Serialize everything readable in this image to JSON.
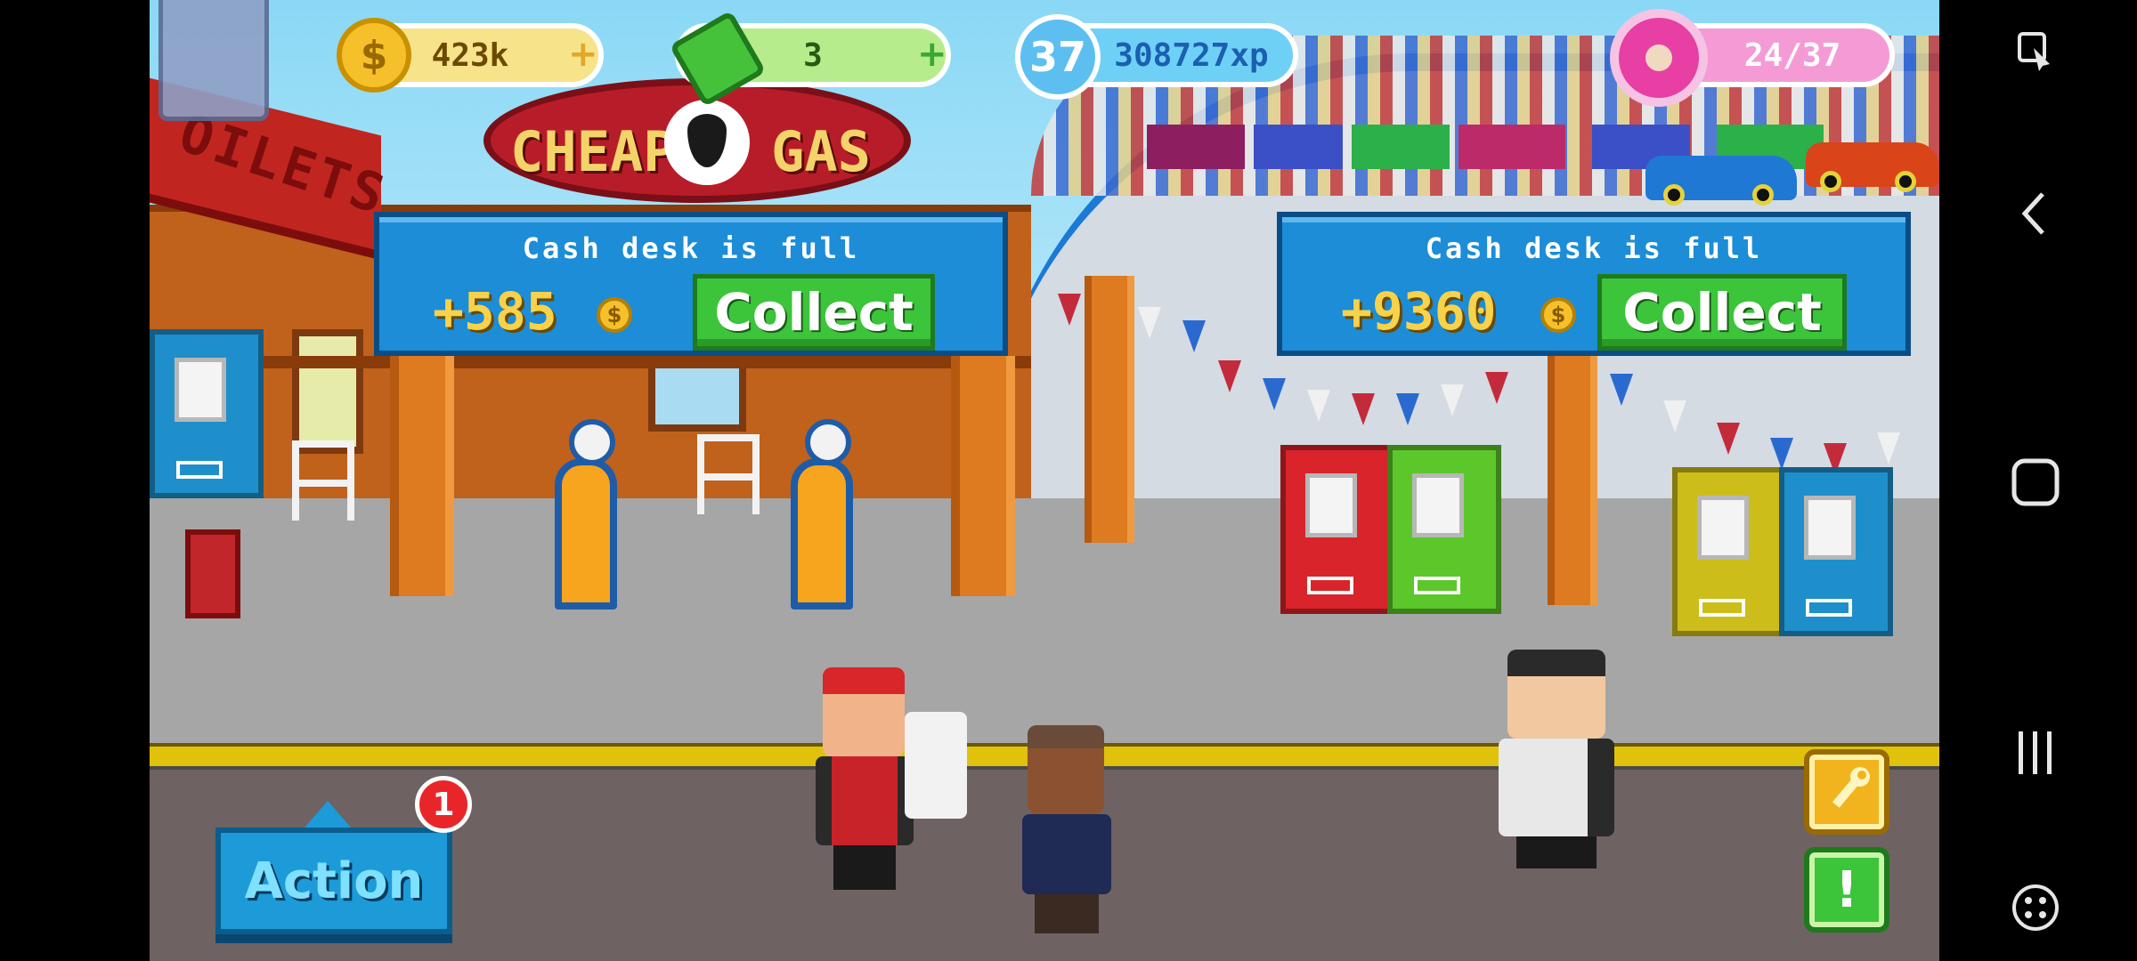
{
  "hud": {
    "coins": "423k",
    "cash": "3",
    "level": "37",
    "xp": "308727xp",
    "donuts": "24/37",
    "coin_symbol": "$",
    "plus": "+"
  },
  "sign": {
    "left": "CHEAP",
    "right": "GAS"
  },
  "building_sign": "OILETS",
  "desk_left": {
    "title": "Cash desk is full",
    "amount": "+585",
    "button": "Collect"
  },
  "desk_right": {
    "title": "Cash desk is full",
    "amount": "+9360",
    "button": "Collect"
  },
  "action": {
    "label": "Action",
    "badge": "1"
  },
  "side_buttons": {
    "wrench": "wrench-icon",
    "alert": "!"
  },
  "colors": {
    "coin_pill": "#f7e38a",
    "cash_pill": "#b6ec8c",
    "xp_pill": "#6fd0f6",
    "donut_pill": "#f49bd5",
    "panel": "#1c8dd6",
    "collect": "#3cc43a"
  },
  "android_nav": [
    "screen-pointer-icon",
    "back-icon",
    "home-icon",
    "recents-icon",
    "gamepad-icon"
  ]
}
